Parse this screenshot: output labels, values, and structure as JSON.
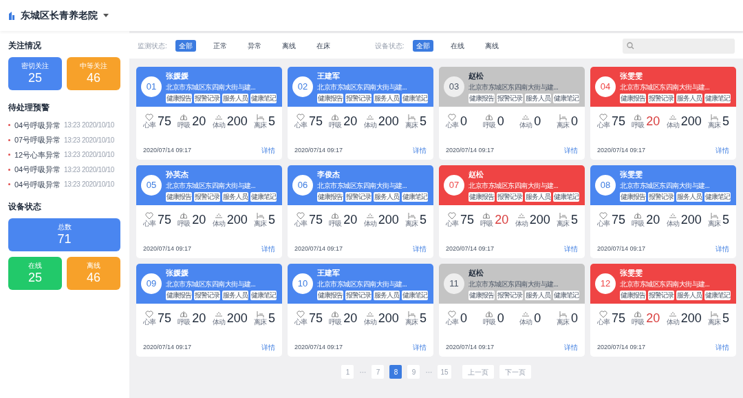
{
  "header": {
    "title": "东城区长青养老院"
  },
  "sidebar": {
    "focus_title": "关注情况",
    "focus_stats": [
      {
        "label": "密切关注",
        "value": "25",
        "color": "#4a86f0"
      },
      {
        "label": "中等关注",
        "value": "46",
        "color": "#f7a12a"
      }
    ],
    "alerts_title": "待处理预警",
    "alerts": [
      {
        "text": "04号呼吸异常",
        "time": "13:23 2020/10/10"
      },
      {
        "text": "07号呼吸异常",
        "time": "13:23 2020/10/10"
      },
      {
        "text": "12号心率异常",
        "time": "13:23 2020/10/10"
      },
      {
        "text": "04号呼吸异常",
        "time": "13:23 2020/10/10"
      },
      {
        "text": "04号呼吸异常",
        "time": "13:23 2020/10/10"
      }
    ],
    "device_title": "设备状态",
    "device_total": {
      "label": "总数",
      "value": "71",
      "color": "#4a86f0"
    },
    "device_stats": [
      {
        "label": "在线",
        "value": "25",
        "color": "#22c96a"
      },
      {
        "label": "离线",
        "value": "46",
        "color": "#f7a12a"
      }
    ]
  },
  "filters": [
    {
      "label": "监测状态:",
      "options": [
        {
          "label": "全部",
          "selected": true
        },
        {
          "label": "正常",
          "selected": false
        },
        {
          "label": "异常",
          "selected": false
        },
        {
          "label": "离线",
          "selected": false
        },
        {
          "label": "在床",
          "selected": false
        }
      ]
    },
    {
      "label": "设备状态:",
      "options": [
        {
          "label": "全部",
          "selected": true
        },
        {
          "label": "在线",
          "selected": false
        },
        {
          "label": "离线",
          "selected": false
        }
      ]
    }
  ],
  "cards": [
    {
      "number": "01",
      "name": "张媛媛",
      "kind": "normal",
      "address": "北京市东城区东四南大街与建...",
      "tags": [
        "健康报告",
        "报警记录",
        "服务人员",
        "健康笔记"
      ],
      "metrics": [
        {
          "label": "心率",
          "value": "75",
          "alert": false
        },
        {
          "label": "呼吸",
          "value": "20",
          "alert": false
        },
        {
          "label": "体动",
          "value": "200",
          "alert": false
        },
        {
          "label": "离床",
          "value": "5",
          "alert": false
        }
      ],
      "time": "2020/07/14 09:17",
      "link": "详情"
    },
    {
      "number": "02",
      "name": "王建军",
      "kind": "normal",
      "address": "北京市东城区东四南大街与建...",
      "tags": [
        "健康报告",
        "报警记录",
        "服务人员",
        "健康笔记"
      ],
      "metrics": [
        {
          "label": "心率",
          "value": "75",
          "alert": false
        },
        {
          "label": "呼吸",
          "value": "20",
          "alert": false
        },
        {
          "label": "体动",
          "value": "200",
          "alert": false
        },
        {
          "label": "离床",
          "value": "5",
          "alert": false
        }
      ],
      "time": "2020/07/14 09:17",
      "link": "详情"
    },
    {
      "number": "03",
      "name": "赵松",
      "kind": "offline",
      "address": "北京市东城区东四南大街与建...",
      "tags": [
        "健康报告",
        "报警记录",
        "服务人员",
        "健康笔记"
      ],
      "metrics": [
        {
          "label": "心率",
          "value": "0",
          "alert": false
        },
        {
          "label": "呼吸",
          "value": "0",
          "alert": false
        },
        {
          "label": "体动",
          "value": "0",
          "alert": false
        },
        {
          "label": "离床",
          "value": "0",
          "alert": false
        }
      ],
      "time": "2020/07/14 09:17",
      "link": "详情"
    },
    {
      "number": "04",
      "name": "张雯雯",
      "kind": "alarm",
      "address": "北京市东城区东四南大街与建...",
      "tags": [
        "健康报告",
        "报警记录",
        "服务人员",
        "健康笔记"
      ],
      "metrics": [
        {
          "label": "心率",
          "value": "75",
          "alert": false
        },
        {
          "label": "呼吸",
          "value": "20",
          "alert": true
        },
        {
          "label": "体动",
          "value": "200",
          "alert": false
        },
        {
          "label": "离床",
          "value": "5",
          "alert": false
        }
      ],
      "time": "2020/07/14 09:17",
      "link": "详情"
    },
    {
      "number": "05",
      "name": "孙英杰",
      "kind": "normal",
      "address": "北京市东城区东四南大街与建...",
      "tags": [
        "健康报告",
        "报警记录",
        "服务人员",
        "健康笔记"
      ],
      "metrics": [
        {
          "label": "心率",
          "value": "75",
          "alert": false
        },
        {
          "label": "呼吸",
          "value": "20",
          "alert": false
        },
        {
          "label": "体动",
          "value": "200",
          "alert": false
        },
        {
          "label": "离床",
          "value": "5",
          "alert": false
        }
      ],
      "time": "2020/07/14 09:17",
      "link": "详情"
    },
    {
      "number": "06",
      "name": "李俊杰",
      "kind": "normal",
      "address": "北京市东城区东四南大街与建...",
      "tags": [
        "健康报告",
        "报警记录",
        "服务人员",
        "健康笔记"
      ],
      "metrics": [
        {
          "label": "心率",
          "value": "75",
          "alert": false
        },
        {
          "label": "呼吸",
          "value": "20",
          "alert": false
        },
        {
          "label": "体动",
          "value": "200",
          "alert": false
        },
        {
          "label": "离床",
          "value": "5",
          "alert": false
        }
      ],
      "time": "2020/07/14 09:17",
      "link": "详情"
    },
    {
      "number": "07",
      "name": "赵松",
      "kind": "alarm",
      "address": "北京市东城区东四南大街与建...",
      "tags": [
        "健康报告",
        "报警记录",
        "服务人员",
        "健康笔记"
      ],
      "metrics": [
        {
          "label": "心率",
          "value": "75",
          "alert": false
        },
        {
          "label": "呼吸",
          "value": "20",
          "alert": true
        },
        {
          "label": "体动",
          "value": "200",
          "alert": false
        },
        {
          "label": "离床",
          "value": "5",
          "alert": false
        }
      ],
      "time": "2020/07/14 09:17",
      "link": "详情"
    },
    {
      "number": "08",
      "name": "张雯雯",
      "kind": "normal",
      "address": "北京市东城区东四南大街与建...",
      "tags": [
        "健康报告",
        "报警记录",
        "服务人员",
        "健康笔记"
      ],
      "metrics": [
        {
          "label": "心率",
          "value": "75",
          "alert": false
        },
        {
          "label": "呼吸",
          "value": "20",
          "alert": false
        },
        {
          "label": "体动",
          "value": "200",
          "alert": false
        },
        {
          "label": "离床",
          "value": "5",
          "alert": false
        }
      ],
      "time": "2020/07/14 09:17",
      "link": "详情"
    },
    {
      "number": "09",
      "name": "张媛媛",
      "kind": "normal",
      "address": "北京市东城区东四南大街与建...",
      "tags": [
        "健康报告",
        "报警记录",
        "服务人员",
        "健康笔记"
      ],
      "metrics": [
        {
          "label": "心率",
          "value": "75",
          "alert": false
        },
        {
          "label": "呼吸",
          "value": "20",
          "alert": false
        },
        {
          "label": "体动",
          "value": "200",
          "alert": false
        },
        {
          "label": "离床",
          "value": "5",
          "alert": false
        }
      ],
      "time": "2020/07/14 09:17",
      "link": "详情"
    },
    {
      "number": "10",
      "name": "王建军",
      "kind": "normal",
      "address": "北京市东城区东四南大街与建...",
      "tags": [
        "健康报告",
        "报警记录",
        "服务人员",
        "健康笔记"
      ],
      "metrics": [
        {
          "label": "心率",
          "value": "75",
          "alert": false
        },
        {
          "label": "呼吸",
          "value": "20",
          "alert": false
        },
        {
          "label": "体动",
          "value": "200",
          "alert": false
        },
        {
          "label": "离床",
          "value": "5",
          "alert": false
        }
      ],
      "time": "2020/07/14 09:17",
      "link": "详情"
    },
    {
      "number": "11",
      "name": "赵松",
      "kind": "offline",
      "address": "北京市东城区东四南大街与建...",
      "tags": [
        "健康报告",
        "报警记录",
        "服务人员",
        "健康笔记"
      ],
      "metrics": [
        {
          "label": "心率",
          "value": "0",
          "alert": false
        },
        {
          "label": "呼吸",
          "value": "0",
          "alert": false
        },
        {
          "label": "体动",
          "value": "0",
          "alert": false
        },
        {
          "label": "离床",
          "value": "0",
          "alert": false
        }
      ],
      "time": "2020/07/14 09:17",
      "link": "详情"
    },
    {
      "number": "12",
      "name": "张雯雯",
      "kind": "alarm",
      "address": "北京市东城区东四南大街与建...",
      "tags": [
        "健康报告",
        "报警记录",
        "服务人员",
        "健康笔记"
      ],
      "metrics": [
        {
          "label": "心率",
          "value": "75",
          "alert": false
        },
        {
          "label": "呼吸",
          "value": "20",
          "alert": true
        },
        {
          "label": "体动",
          "value": "200",
          "alert": false
        },
        {
          "label": "离床",
          "value": "5",
          "alert": false
        }
      ],
      "time": "2020/07/14 09:17",
      "link": "详情"
    }
  ],
  "pagination": {
    "pages": [
      {
        "label": "1",
        "kind": "page",
        "selected": false
      },
      {
        "label": "···",
        "kind": "ellipsis",
        "selected": false
      },
      {
        "label": "7",
        "kind": "page",
        "selected": false
      },
      {
        "label": "8",
        "kind": "page",
        "selected": true
      },
      {
        "label": "9",
        "kind": "page",
        "selected": false
      },
      {
        "label": "···",
        "kind": "ellipsis",
        "selected": false
      },
      {
        "label": "15",
        "kind": "page",
        "selected": false
      }
    ],
    "prev": "上一页",
    "next": "下一页"
  }
}
